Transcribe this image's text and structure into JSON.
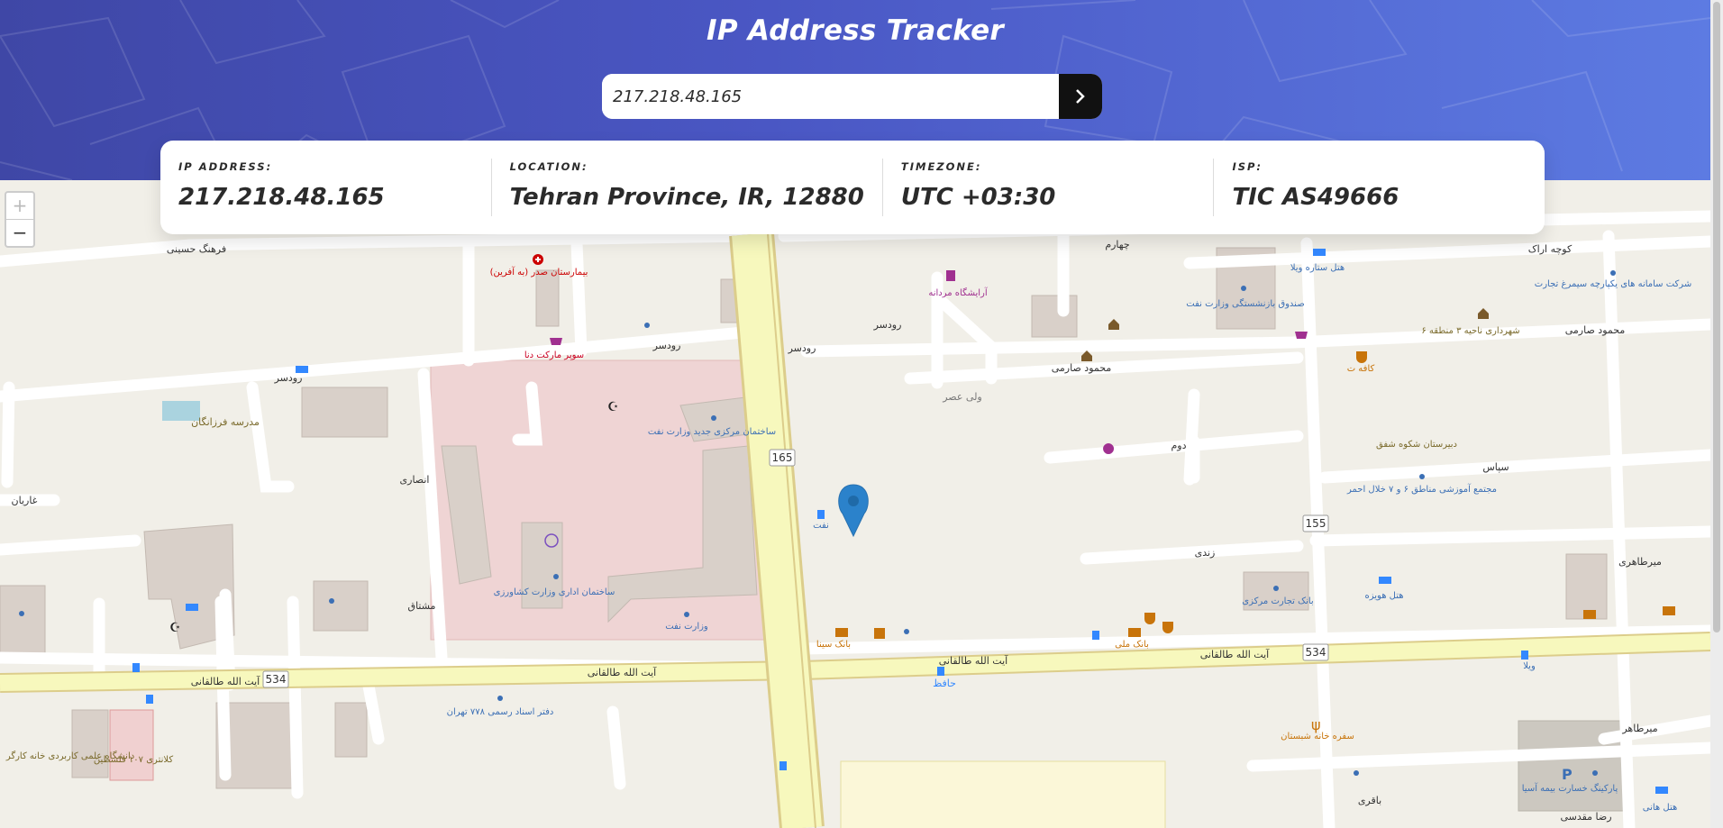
{
  "header": {
    "title": "IP Address Tracker",
    "search_value": "217.218.48.165"
  },
  "info": [
    {
      "label": "IP ADDRESS:",
      "value": "217.218.48.165"
    },
    {
      "label": "LOCATION:",
      "value": "Tehran Province, IR, 12880"
    },
    {
      "label": "TIMEZONE:",
      "value": "UTC +03:30"
    },
    {
      "label": "ISP:",
      "value": "TIC AS49666"
    }
  ],
  "map": {
    "zoom_in": "+",
    "zoom_out": "−",
    "marker_icon": "location-pin-icon",
    "route_shields": [
      "165",
      "155",
      "534",
      "534"
    ],
    "street_labels": [
      "فرهنگ حسینی",
      "رودسر",
      "رودسر",
      "رودسر",
      "رودسر",
      "چهارم",
      "کوچه اراک",
      "محمود صارمی",
      "محمود صارمی",
      "ولی عصر",
      "دوم",
      "سپاس",
      "زندی",
      "میرطاهری",
      "میرطاهر",
      "مشتاق",
      "انصاری",
      "غاریان",
      "آیت الله طالقانی",
      "آیت الله طالقانی",
      "آیت الله طالقانی",
      "آیت الله طالقانی",
      "حافظ",
      "باقری",
      "رضا مقدسی",
      "مدرسه فرزانگان"
    ],
    "poi_labels": [
      "بیمارستان صدر (به آفرین)",
      "سوپر مارکت دنا",
      "ساختمان مرکزی جدید وزارت نفت",
      "ساختمان اداری وزارت کشاورزی",
      "وزارت نفت",
      "آرایشگاه مردانه",
      "صندوق بازنشستگی وزارت نفت",
      "هتل ستاره ویلا",
      "شرکت سامانه های یکپارچه سیمرغ تجارت",
      "کافه ت",
      "دبیرستان شکوه شفق",
      "مجتمع آموزشی مناطق ۶ و ۷ خلال احمر",
      "بانک تجارت مرکزی",
      "هتل هویزه",
      "بانک سینا",
      "بانک ملی",
      "دفتر اسناد رسمی ۷۷۸ تهران",
      "دانشگاه علمی کاربردی خانه کارگر",
      "کلانتری ۱۰۷ فلسطین",
      "سفره خانه شبستان",
      "پارکینگ خسارت بیمه آسیا",
      "هتل هانی",
      "نفت",
      "ویلا",
      "شهرداری ناحیه ۳ منطقه ۶"
    ]
  }
}
